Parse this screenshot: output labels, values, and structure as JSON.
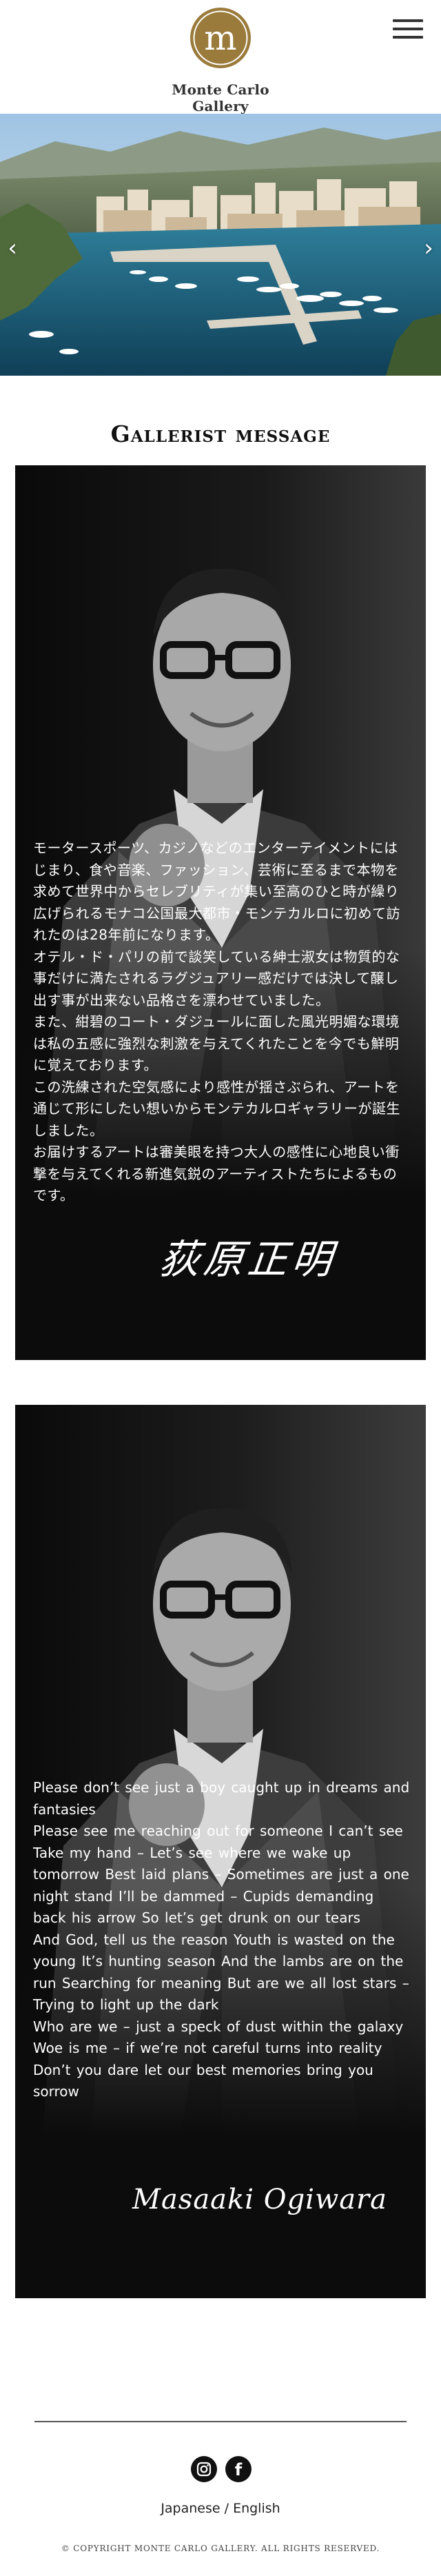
{
  "header": {
    "logo_monogram": "m",
    "logo_text": "Monte Carlo Gallery",
    "menu_icon": "hamburger-menu-icon"
  },
  "hero": {
    "image": "Monaco harbor aerial with yachts and city",
    "prev_icon": "chevron-left-icon",
    "next_icon": "chevron-right-icon",
    "prev_glyph": "‹",
    "next_glyph": "›"
  },
  "section": {
    "title": "Gallerist message"
  },
  "message_ja": {
    "paragraphs": [
      "モータースポーツ、カジノなどのエンターテイメントにはじまり、食や音楽、ファッション、芸術に至るまで本物を求めて世界中からセレブリティが集い至高のひと時が繰り広げられるモナコ公国最大都市・モンテカルロに初めて訪れたのは28年前になります。",
      "オテル・ド・パリの前で談笑している紳士淑女は物質的な事だけに満たされるラグジュアリー感だけでは決して醸し出す事が出来ない品格さを漂わせていました。",
      "また、紺碧のコート・ダジュールに面した風光明媚な環境は私の五感に強烈な刺激を与えてくれたことを今でも鮮明に覚えております。",
      "この洗練された空気感により感性が揺さぶられ、アートを通じて形にしたい想いからモンテカルロギャラリーが誕生しました。",
      "お届けするアートは審美眼を持つ大人の感性に心地良い衝撃を与えてくれる新進気鋭のアーティストたちによるものです。"
    ],
    "signature": "荻原正明"
  },
  "message_en": {
    "lines": [
      "Please don’t see just a boy caught up in dreams and fantasies",
      "Please see me reaching out for someone I can’t see",
      "Take my hand – Let’s see where we wake up tomorrow   Best laid plans – Sometimes are just a one night stand   I’ll be dammed – Cupids demanding back his arrow   So let’s get drunk on our tears",
      "And God, tell us the reason   Youth is wasted on the young   It’s hunting season   And the lambs are on the run   Searching for meaning   But are we all lost stars – Trying to light up the dark",
      "Who are we – just a speck of dust within the galaxy",
      "Woe is me – if we’re not careful turns into reality",
      "Don’t you dare let our best memories bring you sorrow"
    ],
    "signature": "Masaaki Ogiwara"
  },
  "footer": {
    "instagram_icon": "instagram-icon",
    "facebook_icon": "facebook-icon",
    "facebook_glyph": "f",
    "lang_japanese": "Japanese",
    "lang_separator": " / ",
    "lang_english": "English",
    "copyright": "© COPYRIGHT MONTE CARLO GALLERY. ALL RIGHTS RESERVED."
  },
  "colors": {
    "gold": "#9a7b3c",
    "card_bg": "#0c0c0c",
    "text_dark": "#222222"
  }
}
